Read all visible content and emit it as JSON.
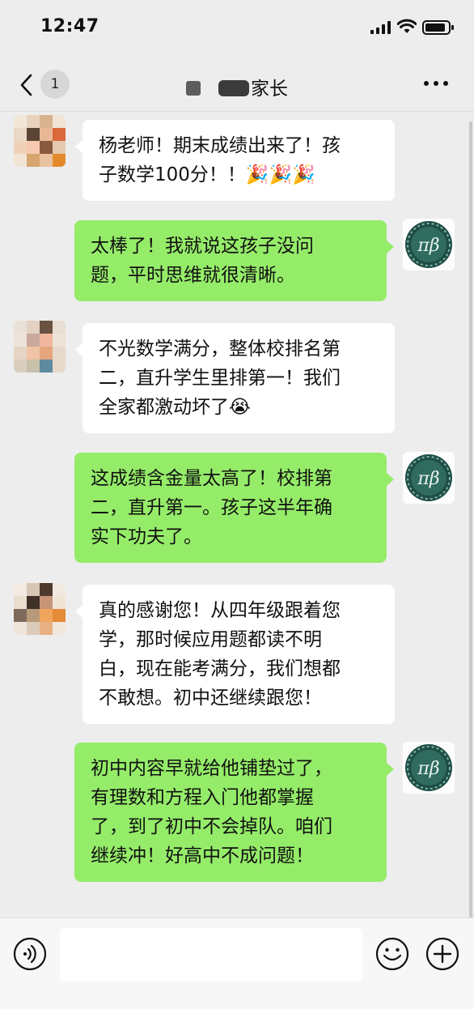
{
  "status_bar": {
    "time": "12:47"
  },
  "nav": {
    "unread_count": "1",
    "title_suffix": "家长"
  },
  "messages": [
    {
      "side": "left",
      "lines": [
        "杨老师！期末成绩出来了！孩",
        "子数学100分！！🎉🎉🎉"
      ]
    },
    {
      "side": "right",
      "lines": [
        "太棒了！我就说这孩子没问",
        "题，平时思维就很清晰。"
      ]
    },
    {
      "side": "left",
      "lines": [
        "不光数学满分，整体校排名第",
        "二，直升学生里排第一！我们",
        "全家都激动坏了😭"
      ]
    },
    {
      "side": "right",
      "lines": [
        "这成绩含金量太高了！校排第",
        "二，直升第一。孩子这半年确",
        "实下功夫了。"
      ]
    },
    {
      "side": "left",
      "lines": [
        "真的感谢您！从四年级跟着您",
        "学，那时候应用题都读不明",
        "白，现在能考满分，我们想都",
        "不敢想。初中还继续跟您！"
      ]
    },
    {
      "side": "right",
      "lines": [
        "初中内容早就给他铺垫过了，",
        "有理数和方程入门他都掌握",
        "了，到了初中不会掉队。咱们",
        "继续冲！好高中不成问题！"
      ]
    }
  ],
  "self_avatar": {
    "text": "πβ",
    "colors": {
      "ring": "#1e4d45",
      "inner": "#2f6b5f",
      "text": "#e8f2ee"
    }
  },
  "colors": {
    "background": "#ededed",
    "bubble_self": "#95ec69",
    "bubble_other": "#ffffff",
    "input_bar": "#f7f7f7"
  },
  "input": {
    "value": "",
    "placeholder": ""
  }
}
